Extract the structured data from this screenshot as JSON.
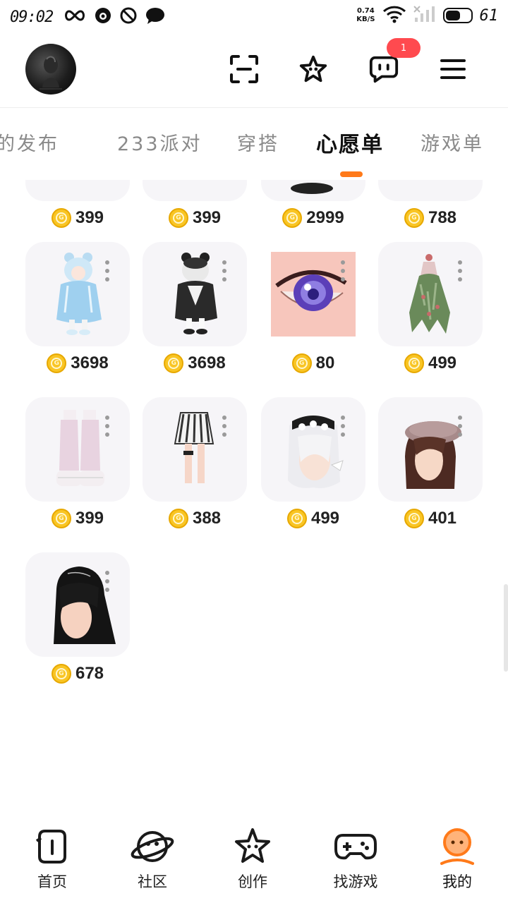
{
  "status_bar": {
    "time": "09:02",
    "net_speed_value": "0.74",
    "net_speed_unit": "KB/S",
    "battery": "61",
    "battery_level": 0.61,
    "icons": [
      "infinity-icon",
      "chat-bubble-icon",
      "block-icon",
      "message-icon",
      "wifi-icon",
      "signal-icon",
      "battery-icon"
    ]
  },
  "header": {
    "icons": [
      "scan-icon",
      "star-icon",
      "messages-icon",
      "menu-icon"
    ],
    "messages_badge": "1",
    "accent_color": "#ff7a1a",
    "badge_color": "#ff4a4f"
  },
  "tabs": {
    "items": [
      {
        "label": "我的发布"
      },
      {
        "label": "233派对"
      },
      {
        "label": "穿搭"
      },
      {
        "label": "心愿单"
      },
      {
        "label": "游戏单"
      }
    ],
    "active_index": 3
  },
  "wishlist": {
    "items": [
      {
        "price": "399",
        "thumb": "partial-item-icon"
      },
      {
        "price": "399",
        "thumb": "partial-item-icon"
      },
      {
        "price": "2999",
        "thumb": "partial-item-icon"
      },
      {
        "price": "788",
        "thumb": "partial-item-icon"
      },
      {
        "price": "3698",
        "thumb": "blue-bear-outfit-icon"
      },
      {
        "price": "3698",
        "thumb": "black-bear-outfit-icon"
      },
      {
        "price": "80",
        "thumb": "purple-eye-icon"
      },
      {
        "price": "499",
        "thumb": "green-floral-dress-icon"
      },
      {
        "price": "399",
        "thumb": "pink-boots-icon"
      },
      {
        "price": "388",
        "thumb": "striped-skirt-icon"
      },
      {
        "price": "499",
        "thumb": "white-hair-bow-icon"
      },
      {
        "price": "401",
        "thumb": "brown-hair-beret-icon"
      },
      {
        "price": "678",
        "thumb": "long-black-hair-icon"
      }
    ]
  },
  "bottom_nav": {
    "items": [
      {
        "label": "首页",
        "icon": "home-icon"
      },
      {
        "label": "社区",
        "icon": "planet-icon"
      },
      {
        "label": "创作",
        "icon": "star-create-icon"
      },
      {
        "label": "找游戏",
        "icon": "gamepad-icon"
      },
      {
        "label": "我的",
        "icon": "profile-icon"
      }
    ],
    "active_index": 4
  }
}
